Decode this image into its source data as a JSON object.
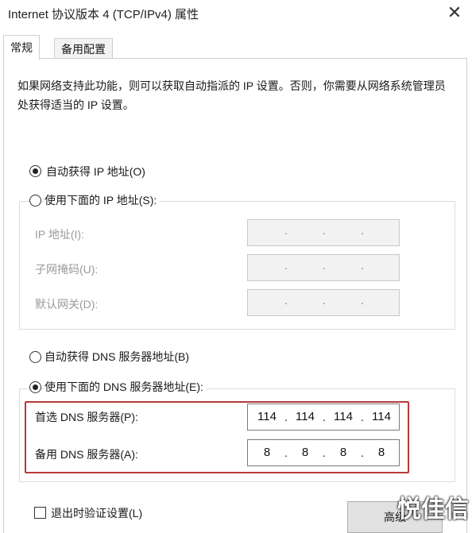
{
  "window": {
    "title": "Internet 协议版本 4 (TCP/IPv4) 属性",
    "close_glyph": "✕"
  },
  "tabs": [
    {
      "label": "常规"
    },
    {
      "label": "备用配置"
    }
  ],
  "intro_text": "如果网络支持此功能，则可以获取自动指派的 IP 设置。否则，你需要从网络系统管理员处获得适当的 IP 设置。",
  "ip_options": {
    "auto_label": "自动获得 IP 地址(O)",
    "auto_selected": true,
    "manual_label": "使用下面的 IP 地址(S):",
    "manual_selected": false
  },
  "ip_fields": [
    {
      "label": "IP 地址(I):",
      "value": ""
    },
    {
      "label": "子网掩码(U):",
      "value": ""
    },
    {
      "label": "默认网关(D):",
      "value": ""
    }
  ],
  "dns_options": {
    "auto_label": "自动获得 DNS 服务器地址(B)",
    "auto_selected": false,
    "manual_label": "使用下面的 DNS 服务器地址(E):",
    "manual_selected": true
  },
  "dns_fields": [
    {
      "label": "首选 DNS 服务器(P):",
      "octets": [
        "114",
        "114",
        "114",
        "114"
      ]
    },
    {
      "label": "备用 DNS 服务器(A):",
      "octets": [
        "8",
        "8",
        "8",
        "8"
      ]
    }
  ],
  "validate_on_exit": {
    "label": "退出时验证设置(L)",
    "checked": false
  },
  "advanced_button": "高级",
  "watermark": "悦佳信",
  "colors": {
    "highlight_frame": "#b53a3a",
    "disabled_text": "#9a9a9a"
  }
}
